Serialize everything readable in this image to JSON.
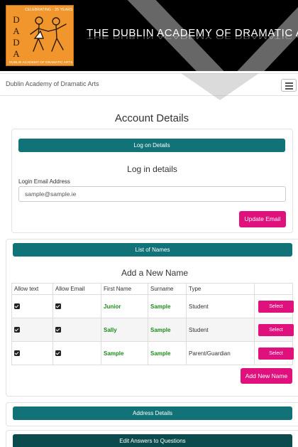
{
  "banner": {
    "logo": {
      "celebrating": "CELEBRATING · 25 YEARS",
      "letters": [
        "D",
        "A",
        "D",
        "A"
      ],
      "academy": "DUBLIN ACADEMY OF DRAMATIC ARTS"
    },
    "title": "THE DUBLIN ACADEMY OF DRAMATIC ARTS",
    "colors": {
      "background": "#000000",
      "logo_orange": "#f0962c"
    }
  },
  "navbar": {
    "brand": "Dublin Academy of Dramatic Arts",
    "toggle_icon": "hamburger-menu-icon"
  },
  "page": {
    "title": "Account Details"
  },
  "logon": {
    "bar_label": "Log on Details",
    "heading": "Log in details",
    "email_label": "Login Email Address",
    "email_value": "sample@sample.ie",
    "update_button": "Update Email"
  },
  "names": {
    "bar_label": "List of Names",
    "heading": "Add a New Name",
    "columns": [
      "Allow text",
      "Allow Email",
      "First Name",
      "Surname",
      "Type",
      ""
    ],
    "rows": [
      {
        "allow_text": true,
        "allow_email": true,
        "first_name": "Junior",
        "surname": "Sample",
        "type": "Student",
        "action": "Select"
      },
      {
        "allow_text": true,
        "allow_email": true,
        "first_name": "Sally",
        "surname": "Sample",
        "type": "Student",
        "action": "Select"
      },
      {
        "allow_text": true,
        "allow_email": true,
        "first_name": "Sample",
        "surname": "Sample",
        "type": "Parent/Guardian",
        "action": "Select"
      }
    ],
    "add_button": "Add New Name"
  },
  "address": {
    "bar_label": "Address Details"
  },
  "questions": {
    "bar_label": "Edit Answers to Questions"
  },
  "colors": {
    "teal": "#117377",
    "dark_teal": "#0b4a4d",
    "pink": "#e0107c",
    "green_text": "#1e8a1e"
  }
}
